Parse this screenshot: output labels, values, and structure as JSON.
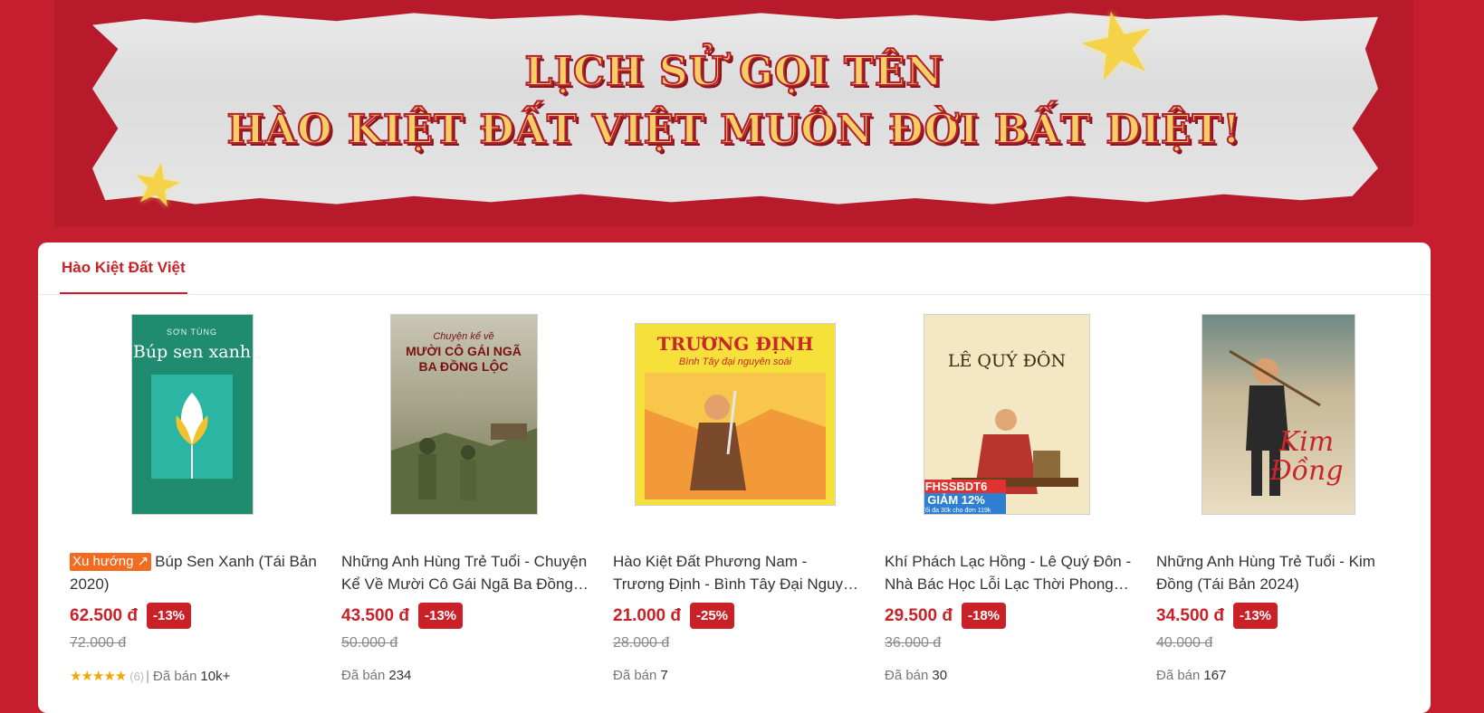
{
  "banner": {
    "line1": "LỊCH SỬ GỌI TÊN",
    "line2": "HÀO KIỆT ĐẤT VIỆT MUÔN ĐỜI BẤT DIỆT!"
  },
  "tabs": [
    {
      "label": "Hào Kiệt Đất Việt",
      "active": true
    }
  ],
  "sold_label": "Đã bán",
  "products": [
    {
      "trend_badge": "Xu hướng",
      "title": "Búp Sen Xanh (Tái Bản 2020)",
      "price": "62.500 đ",
      "discount": "-13%",
      "old_price": "72.000 đ",
      "rating_stars": "★★★★★",
      "review_count": "(6)",
      "sold": "10k+",
      "cover": {
        "author": "SƠN TÙNG",
        "name": "Búp sen xanh",
        "bg": "#1f8c6f"
      }
    },
    {
      "title": "Những Anh Hùng Trẻ Tuổi - Chuyện Kể Về Mười Cô Gái Ngã Ba Đồng Lộc",
      "price": "43.500 đ",
      "discount": "-13%",
      "old_price": "50.000 đ",
      "sold": "234",
      "cover": {
        "series": "Chuyện kể về",
        "name": "MƯỜI CÔ GÁI NGÃ BA ĐỒNG LỘC",
        "bg": "#8a8f6a"
      }
    },
    {
      "title": "Hào Kiệt Đất Phương Nam - Trương Định - Bình Tây Đại Nguyên Soái",
      "price": "21.000 đ",
      "discount": "-25%",
      "old_price": "28.000 đ",
      "sold": "7",
      "cover": {
        "name": "TRƯƠNG ĐỊNH",
        "subtitle": "Bình Tây đại nguyên soái",
        "bg": "#f6e03a"
      }
    },
    {
      "title": "Khí Phách Lạc Hồng - Lê Quý Đôn - Nhà Bác Học Lỗi Lạc Thời Phong Kiến",
      "price": "29.500 đ",
      "discount": "-18%",
      "old_price": "36.000 đ",
      "sold": "30",
      "cover": {
        "name": "LÊ QUÝ ĐÔN",
        "promo_code": "FHSSBDT6",
        "promo_text": "GIẢM 12%",
        "promo_sub": "Tối đa 30k cho đơn 119k",
        "bg": "#f3e7c4"
      }
    },
    {
      "title": "Những Anh Hùng Trẻ Tuổi - Kim Đồng (Tái Bản 2024)",
      "price": "34.500 đ",
      "discount": "-13%",
      "old_price": "40.000 đ",
      "sold": "167",
      "cover": {
        "name": "Kim Đồng",
        "bg": "#e9dcc0"
      }
    }
  ]
}
